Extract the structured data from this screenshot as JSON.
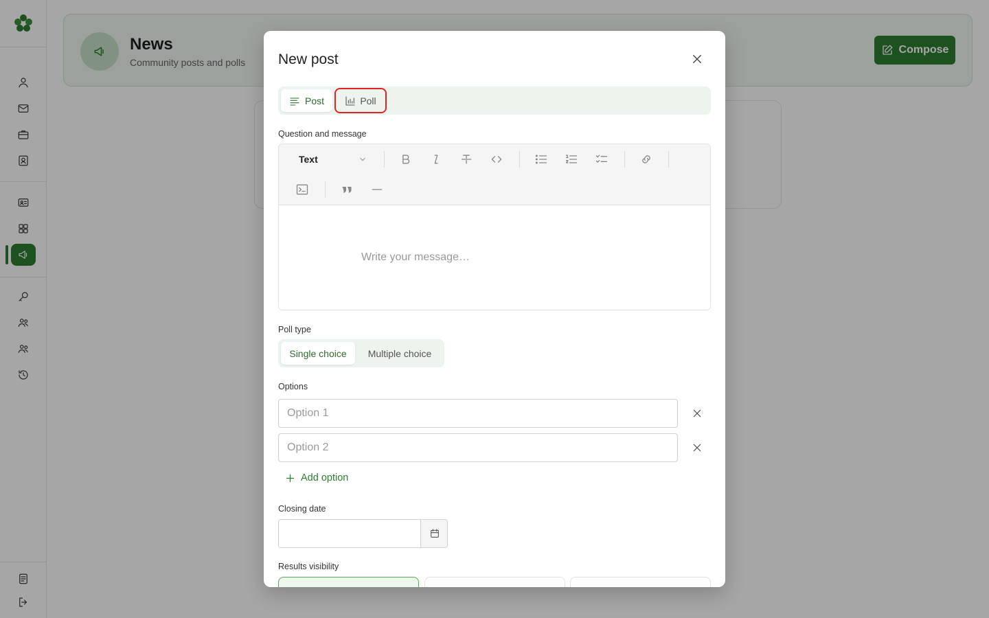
{
  "page": {
    "title": "News",
    "subtitle": "Community posts and polls",
    "compose_label": "Compose"
  },
  "sidebar": {
    "items": [
      {
        "icon": "user-icon"
      },
      {
        "icon": "mail-icon"
      },
      {
        "icon": "briefcase-icon"
      },
      {
        "icon": "contact-book-icon"
      },
      {
        "icon": "id-card-icon"
      },
      {
        "icon": "grid-icon"
      },
      {
        "icon": "megaphone-icon",
        "active": true
      },
      {
        "icon": "key-icon"
      },
      {
        "icon": "people-icon"
      },
      {
        "icon": "people-icon"
      },
      {
        "icon": "history-icon"
      },
      {
        "icon": "document-icon"
      },
      {
        "icon": "logout-icon"
      }
    ]
  },
  "modal": {
    "title": "New post",
    "tabs": {
      "post": "Post",
      "poll": "Poll",
      "selected": "Poll"
    },
    "message_label": "Question and message",
    "editor": {
      "block_type": "Text",
      "placeholder": "Write your message…"
    },
    "poll_type": {
      "label": "Poll type",
      "single": "Single choice",
      "multiple": "Multiple choice",
      "selected": "Single choice"
    },
    "options": {
      "label": "Options",
      "items": [
        {
          "placeholder": "Option 1",
          "value": ""
        },
        {
          "placeholder": "Option 2",
          "value": ""
        }
      ],
      "add_label": "Add option"
    },
    "closing_date": {
      "label": "Closing date",
      "value": ""
    },
    "results_visibility": {
      "label": "Results visibility"
    }
  },
  "colors": {
    "accent": "#2e7d32",
    "highlight": "#e02424"
  }
}
